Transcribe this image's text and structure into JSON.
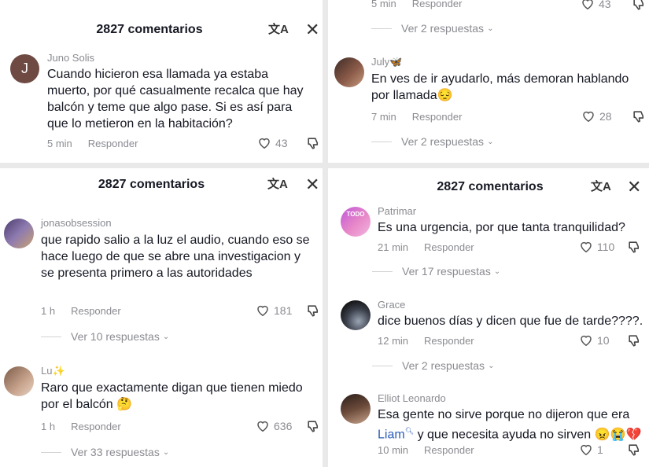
{
  "header": {
    "title": "2827 comentarios"
  },
  "p1": {
    "comment": {
      "user": "Juno Solis",
      "avatar_letter": "J",
      "text": "Cuando hicieron esa llamada ya estaba muerto, por qué casualmente recalca que hay balcón y teme que algo pase. Si es así para que lo metieron en la habitación?",
      "time": "5 min",
      "reply": "Responder",
      "likes": "43"
    }
  },
  "p2": {
    "top": {
      "time": "5 min",
      "reply": "Responder",
      "likes": "43",
      "view_replies": "Ver 2 respuestas"
    },
    "comment": {
      "user": "July🦋",
      "text": "En ves de ir ayudarlo, más demoran hablando por llamada😔",
      "time": "7 min",
      "reply": "Responder",
      "likes": "28",
      "view_replies": "Ver 2 respuestas"
    }
  },
  "p3": {
    "c1": {
      "user": "jonasobsession",
      "text": "que rapido salio a la luz el audio, cuando eso se hace luego de que se abre una investigacion y se presenta primero a las autoridades",
      "time": "1 h",
      "reply": "Responder",
      "likes": "181",
      "view_replies": "Ver 10 respuestas"
    },
    "c2": {
      "user": "Lu✨",
      "text": "Raro que exactamente digan que tienen miedo por el balcón 🤔",
      "time": "1 h",
      "reply": "Responder",
      "likes": "636",
      "view_replies": "Ver 33 respuestas"
    }
  },
  "p4": {
    "c1": {
      "user": "Patrimar",
      "avatar_text": "TODO",
      "text": "Es una urgencia, por que tanta tranquilidad?",
      "time": "21 min",
      "reply": "Responder",
      "likes": "110",
      "view_replies": "Ver 17 respuestas"
    },
    "c2": {
      "user": "Grace",
      "text": "dice buenos días y dicen que fue de tarde????.",
      "time": "12 min",
      "reply": "Responder",
      "likes": "10",
      "view_replies": "Ver 2 respuestas"
    },
    "c3": {
      "user": "Elliot Leonardo",
      "text_a": "Esa gente no sirve porque no dijeron que era",
      "mention": "Liam",
      "text_b": " y que necesita ayuda no sirven 😠😭💔",
      "time": "10 min",
      "reply": "Responder",
      "likes": "1"
    }
  }
}
